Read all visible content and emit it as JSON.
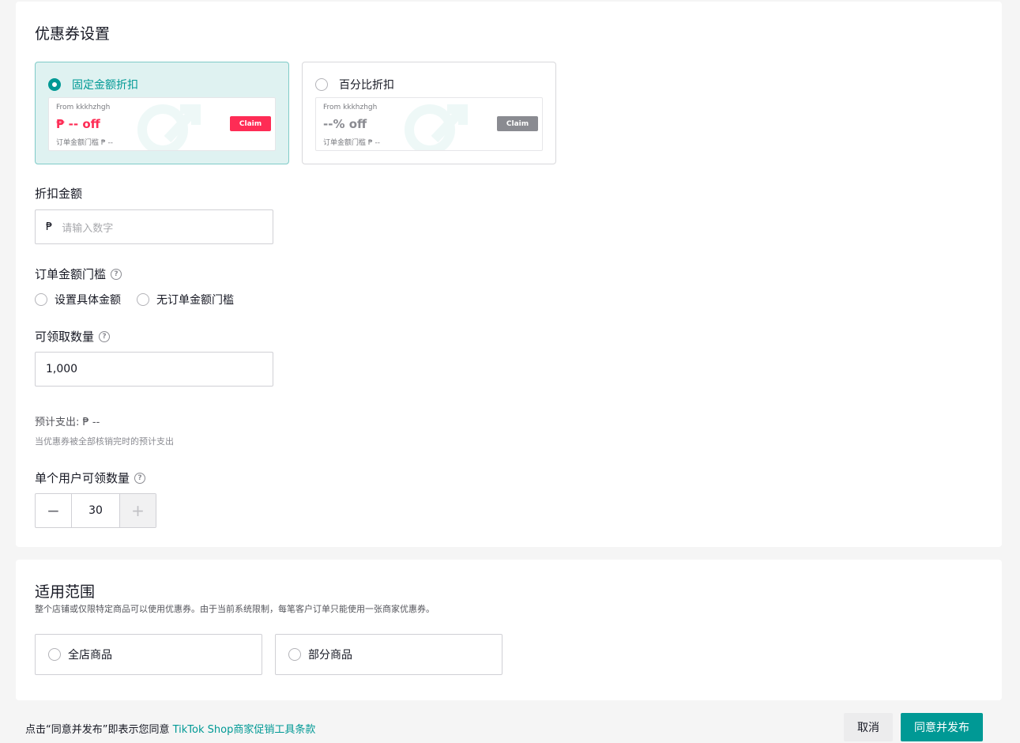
{
  "coupon_settings": {
    "title": "优惠券设置",
    "discount_types": [
      {
        "label": "固定金额折扣",
        "selected": true,
        "preview": {
          "from": "From kkkhzhgh",
          "off_text": "₱ -- off",
          "min_text": "订单金额门槛 ₱ --",
          "claim": "Claim",
          "claim_color": "#fe2c55",
          "off_color": "#fe2c55"
        }
      },
      {
        "label": "百分比折扣",
        "selected": false,
        "preview": {
          "from": "From kkkhzhgh",
          "off_text": "--% off",
          "min_text": "订单金额门槛 ₱ --",
          "claim": "Claim",
          "claim_color": "#8a8b91",
          "off_color": "#8a8b91"
        }
      }
    ],
    "discount_amount": {
      "label": "折扣金额",
      "currency": "₱",
      "placeholder": "请输入数字"
    },
    "min_order": {
      "label": "订单金额门槛",
      "options": [
        "设置具体金额",
        "无订单金额门槛"
      ]
    },
    "claimable_qty": {
      "label": "可领取数量",
      "value": "1,000"
    },
    "estimated_cost": {
      "label": "预计支出: ₱ --",
      "note": "当优惠券被全部核销完时的预计支出"
    },
    "per_user_qty": {
      "label": "单个用户可领数量",
      "value": "30",
      "minus": "−",
      "plus": "+"
    }
  },
  "scope": {
    "title": "适用范围",
    "description": "整个店铺或仅限特定商品可以使用优惠券。由于当前系统限制，每笔客户订单只能使用一张商家优惠券。",
    "options": [
      "全店商品",
      "部分商品"
    ]
  },
  "footer": {
    "agreement_prefix": "点击“同意并发布”即表示您同意 ",
    "agreement_link": "TikTok Shop商家促销工具条款",
    "cancel": "取消",
    "publish": "同意并发布"
  },
  "colors": {
    "accent": "#009995",
    "claim_red": "#fe2c55"
  }
}
